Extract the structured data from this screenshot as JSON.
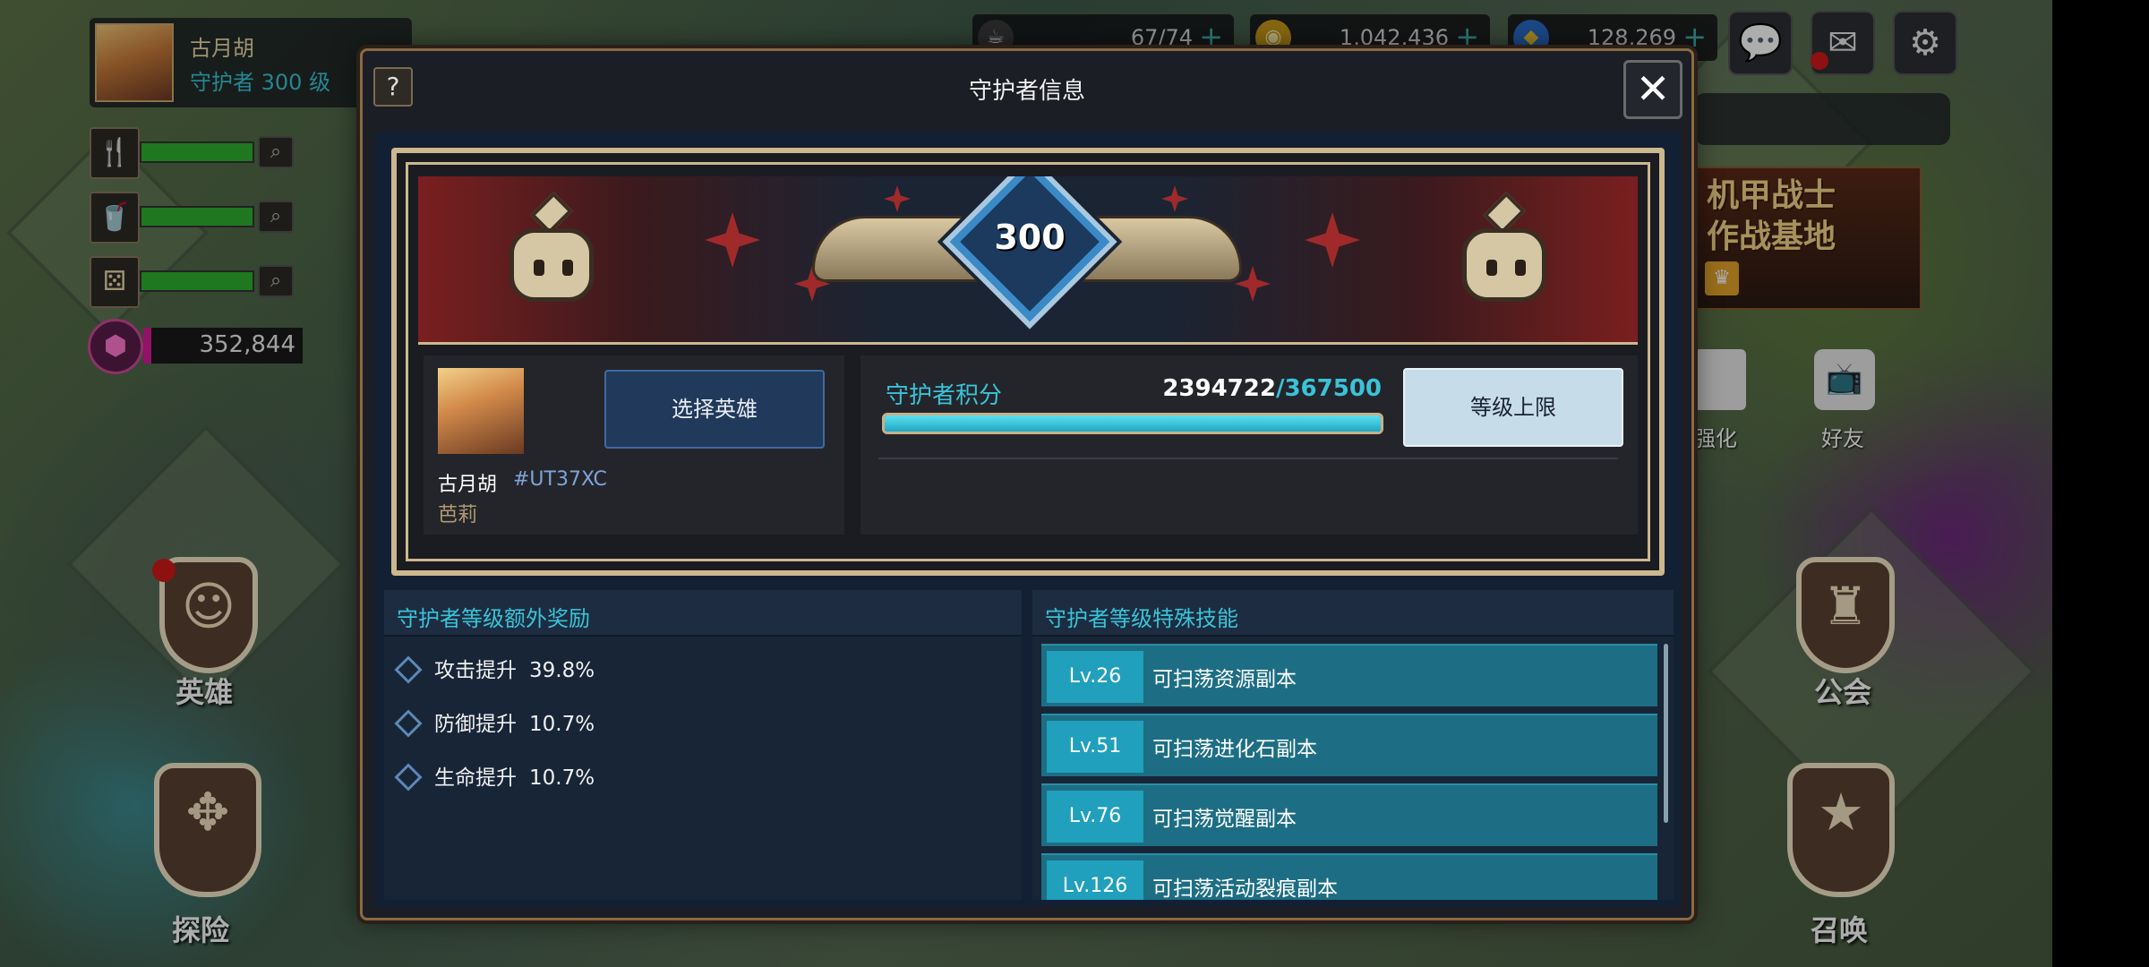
{
  "player": {
    "name": "古月胡",
    "level_text": "守护者 300 级"
  },
  "stats": [
    {
      "icon": "fork-knife-icon",
      "glyph": "🍴",
      "fill": 1.0
    },
    {
      "icon": "drink-cup-icon",
      "glyph": "🥤",
      "fill": 1.0
    },
    {
      "icon": "dice-icon",
      "glyph": "⚄",
      "fill": 1.0
    }
  ],
  "gem": {
    "value": "352,844",
    "fill": 0.05,
    "color": "#d81b9a"
  },
  "currencies": [
    {
      "icon": "coffee-icon",
      "value": "67/74"
    },
    {
      "icon": "gold-coin-icon",
      "value": "1,042,436"
    },
    {
      "icon": "blue-gem-icon",
      "value": "128,269"
    }
  ],
  "top_bar": {
    "partial_title": "守护者"
  },
  "side": {
    "event_title": "机甲战士\n作战基地",
    "enhance_label": "强化",
    "friend_label": "好友",
    "hero_label": "英雄",
    "guild_label": "公会",
    "explore_label": "探险",
    "summon_label": "召唤"
  },
  "modal": {
    "title": "守护者信息",
    "help": "?",
    "close": "✕",
    "level": "300",
    "profile": {
      "name": "古月胡",
      "tag": "#UT37XC",
      "hero": "芭莉",
      "select_hero_label": "选择英雄"
    },
    "points": {
      "label": "守护者积分",
      "current": "2394722",
      "separator": "/",
      "max": "367500",
      "fill": 1.0,
      "level_cap_label": "等级上限"
    },
    "bonus": {
      "title": "守护者等级额外奖励",
      "items": [
        {
          "name": "攻击提升",
          "value": "39.8%"
        },
        {
          "name": "防御提升",
          "value": "10.7%"
        },
        {
          "name": "生命提升",
          "value": "10.7%"
        }
      ]
    },
    "skills": {
      "title": "守护者等级特殊技能",
      "items": [
        {
          "level": "Lv.26",
          "text": "可扫荡资源副本"
        },
        {
          "level": "Lv.51",
          "text": "可扫荡进化石副本"
        },
        {
          "level": "Lv.76",
          "text": "可扫荡觉醒副本"
        },
        {
          "level": "Lv.126",
          "text": "可扫荡活动裂痕副本"
        }
      ]
    }
  },
  "colors": {
    "accent_cyan": "#3ac3d8",
    "modal_border": "#8a6a44",
    "skill_row": "#1d6e84",
    "stat_green": "#2fb12f"
  }
}
